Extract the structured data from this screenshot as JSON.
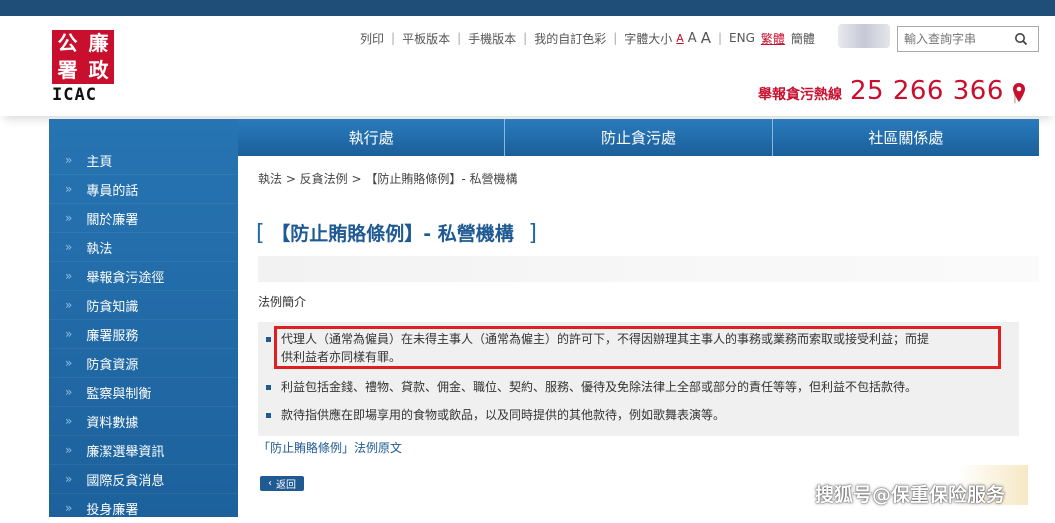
{
  "logo": {
    "seal_chars": [
      "廉",
      "公",
      "政",
      "署"
    ],
    "text": "ICAC"
  },
  "toplinks": {
    "print": "列印",
    "tablet": "平板版本",
    "mobile": "手機版本",
    "colors": "我的自訂色彩",
    "fontsize": "字體大小",
    "a_small": "A",
    "a_medium": "A",
    "a_large": "A",
    "eng": "ENG",
    "trad": "繁體",
    "simp": "簡體"
  },
  "search": {
    "placeholder": "輸入查詢字串"
  },
  "hotline": {
    "label": "舉報貪污熱線",
    "number": "25 266 366"
  },
  "navtabs": [
    "執行處",
    "防止貪污處",
    "社區關係處"
  ],
  "sidebar": {
    "items": [
      "主頁",
      "專員的話",
      "關於廉署",
      "執法",
      "舉報貪污途徑",
      "防貪知識",
      "廉署服務",
      "防貪資源",
      "監察與制衡",
      "資料數據",
      "廉潔選舉資訊",
      "國際反貪消息",
      "投身廉署"
    ]
  },
  "breadcrumb": "執法 > 反貪法例 > 【防止賄賂條例】- 私營機構",
  "page_title": "【防止賄賂條例】- 私營機構",
  "section_title": "法例簡介",
  "bullets": [
    "代理人（通常為僱員）在未得主事人（通常為僱主）的許可下，不得因辦理其主事人的事務或業務而索取或接受利益；而提",
    "供利益者亦同樣有罪。",
    "利益包括金錢、禮物、貸款、佣金、職位、契約、服務、優待及免除法律上全部或部分的責任等等，但利益不包括款待。",
    "款待指供應在即場享用的食物或飲品，以及同時提供的其他款待，例如歌舞表演等。"
  ],
  "law_link": "「防止賄賂條例」法例原文",
  "back_button": "返回",
  "watermark": "搜狐号@保重保险服务",
  "colors": {
    "brand_blue": "#1f6aa5",
    "brand_red": "#c8102e",
    "highlight_red": "#e02020"
  }
}
